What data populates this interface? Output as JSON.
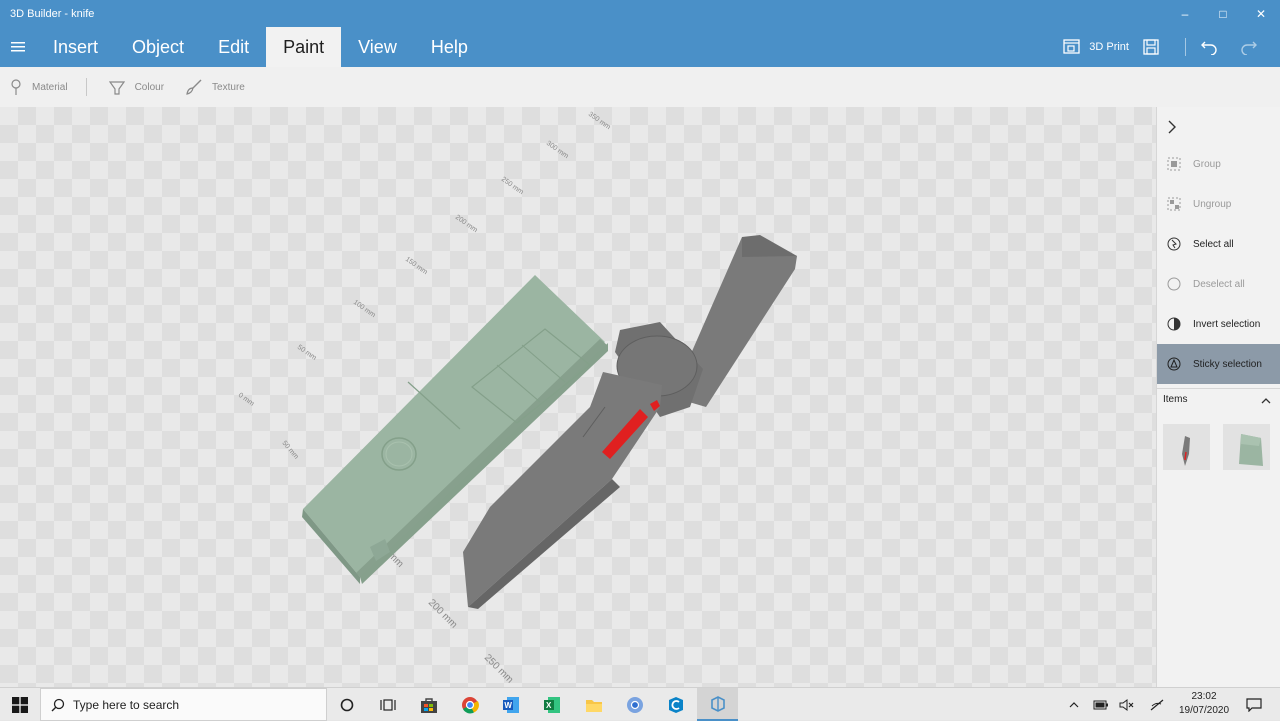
{
  "window": {
    "title": "3D Builder - knife",
    "minimize_icon": "minimize-icon",
    "maximize_icon": "maximize-icon",
    "close_icon": "close-icon"
  },
  "menu": {
    "items": [
      {
        "label": "Insert"
      },
      {
        "label": "Object"
      },
      {
        "label": "Edit"
      },
      {
        "label": "Paint",
        "active": true
      },
      {
        "label": "View"
      },
      {
        "label": "Help"
      }
    ],
    "print_label": "3D Print"
  },
  "paint_toolbar": {
    "material": "Material",
    "colour": "Colour",
    "texture": "Texture"
  },
  "viewport": {
    "ruler_back": [
      "350 mm",
      "300 mm",
      "250 mm",
      "200 mm",
      "150 mm",
      "100 mm",
      "50 mm",
      "0 mm",
      "50 mm"
    ],
    "ruler_front": [
      "mm",
      "200 mm",
      "250 mm"
    ],
    "objects": [
      {
        "name": "knife",
        "color": "#7a7a7a",
        "highlight": "#e02020"
      },
      {
        "name": "sheath",
        "color": "#9bb5a2"
      }
    ]
  },
  "panel": {
    "actions": [
      {
        "label": "Group",
        "enabled": false
      },
      {
        "label": "Ungroup",
        "enabled": false
      },
      {
        "label": "Select all",
        "enabled": true
      },
      {
        "label": "Deselect all",
        "enabled": false
      },
      {
        "label": "Invert selection",
        "enabled": true
      },
      {
        "label": "Sticky selection",
        "enabled": true,
        "selected": true
      }
    ],
    "items_title": "Items"
  },
  "taskbar": {
    "search_placeholder": "Type here to search",
    "time": "23:02",
    "date": "19/07/2020"
  },
  "colors": {
    "accent": "#4a90c8",
    "sheath": "#9bb5a2",
    "blade": "#7a7a7a",
    "edge": "#e02020",
    "selection": "#8c9aa8"
  }
}
